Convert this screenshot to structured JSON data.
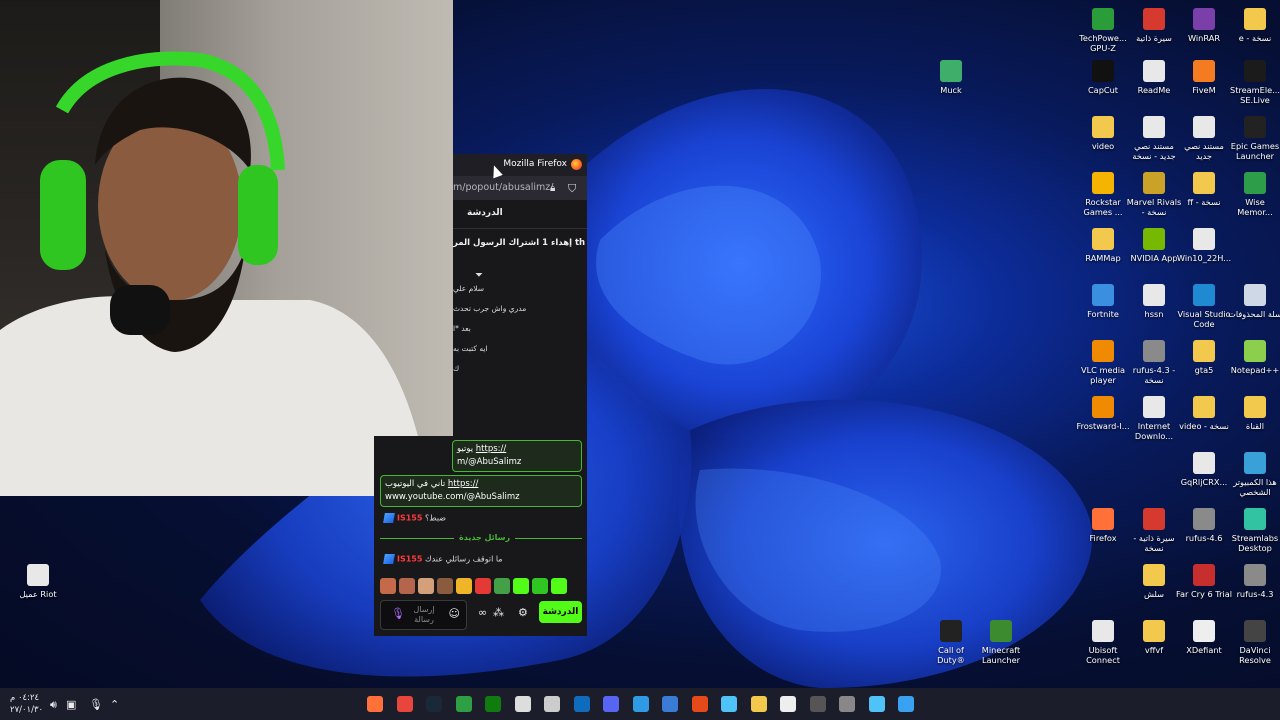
{
  "window": {
    "title": "Mozilla Firefox",
    "url": "m/popout/abusalimz/"
  },
  "chat": {
    "header": "الدردشة",
    "pinned": "إهداء 1 اشتراك الرسول المر th",
    "messages": [
      "سلام علي",
      "مدري واش جرب تحدث",
      "بعد *ا",
      "ايه كتبت به",
      "ك"
    ],
    "link_box_1": {
      "prefix": "يوتيو",
      "link": "https://",
      "line2": "m/@AbuSalimz"
    },
    "link_box_2": {
      "prefix": "تاني في اليوتيوب",
      "link": "https://",
      "line2": "www.youtube.com/@AbuSalimz"
    },
    "user": "IS155",
    "message_1": "ضبط؟",
    "new_messages_label": "رسائل جديدة",
    "message_2": "ما اتوقف رسائلي عندك",
    "input_placeholder": "إرسال رسالة",
    "send_label": "الدردشة"
  },
  "desktop_icons": [
    {
      "label": "TechPowe... GPU-Z",
      "color": "#2a9d3a"
    },
    {
      "label": "سيرة ذاتية",
      "color": "#d63a2f"
    },
    {
      "label": "WinRAR",
      "color": "#7a3fa8"
    },
    {
      "label": "e - نسخة",
      "color": "#f2c94c"
    },
    {
      "label": "Muck",
      "color": "#3fae6a"
    },
    {
      "label": "CapCut",
      "color": "#111111"
    },
    {
      "label": "ReadMe",
      "color": "#e8e8e8"
    },
    {
      "label": "FiveM",
      "color": "#f47b20"
    },
    {
      "label": "StreamEle... SE.Live",
      "color": "#1b1b1b"
    },
    {
      "label": "video",
      "color": "#f2c94c"
    },
    {
      "label": "مستند نصي جديد - نسخة",
      "color": "#e8e8e8"
    },
    {
      "label": "مستند نصي جديد",
      "color": "#e8e8e8"
    },
    {
      "label": "Epic Games Launcher",
      "color": "#222222"
    },
    {
      "label": "Rockstar Games ...",
      "color": "#f4b400"
    },
    {
      "label": "Marvel Rivals - نسخة",
      "color": "#c9a227"
    },
    {
      "label": "ff - نسخة",
      "color": "#f2c94c"
    },
    {
      "label": "Wise Memor...",
      "color": "#2e9d4a"
    },
    {
      "label": "RAMMap",
      "color": "#f2c94c"
    },
    {
      "label": "NVIDIA App",
      "color": "#76b900"
    },
    {
      "label": "Win10_22H...",
      "color": "#e8e8e8"
    },
    {
      "label": "Fortnite",
      "color": "#3b8fe0"
    },
    {
      "label": "hssn",
      "color": "#e8e8e8"
    },
    {
      "label": "Visual Studio Code",
      "color": "#1f8ad2"
    },
    {
      "label": "سلة المحذوفات",
      "color": "#cfd8e6"
    },
    {
      "label": "VLC media player",
      "color": "#f08a00"
    },
    {
      "label": "rufus-4.3 - نسخة",
      "color": "#8a8a8a"
    },
    {
      "label": "gta5",
      "color": "#f2c94c"
    },
    {
      "label": "Notepad++",
      "color": "#8ccf4d"
    },
    {
      "label": "Frostward-I...",
      "color": "#f08a00"
    },
    {
      "label": "Internet Downlo...",
      "color": "#e8e8e8"
    },
    {
      "label": "video - نسخة",
      "color": "#f2c94c"
    },
    {
      "label": "القناة",
      "color": "#f2c94c"
    },
    {
      "label": "GqRljCRX...",
      "color": "#e8e8e8"
    },
    {
      "label": "هذا الكمبيوتر الشخصي",
      "color": "#3aa0d8"
    },
    {
      "label": "Firefox",
      "color": "#ff7139"
    },
    {
      "label": "سيرة ذاتية - نسخة",
      "color": "#d63a2f"
    },
    {
      "label": "rufus-4.6",
      "color": "#8a8a8a"
    },
    {
      "label": "Streamlabs Desktop",
      "color": "#31c3a2"
    },
    {
      "label": "عميل Riot",
      "color": "#e8e8e8"
    },
    {
      "label": "سلش",
      "color": "#f2c94c"
    },
    {
      "label": "Far Cry 6 Trial",
      "color": "#c72f2f"
    },
    {
      "label": "rufus-4.3",
      "color": "#8a8a8a"
    },
    {
      "label": "Call of Duty®",
      "color": "#222222"
    },
    {
      "label": "Minecraft Launcher",
      "color": "#3d8b2f"
    },
    {
      "label": "Ubisoft Connect",
      "color": "#e8e8e8"
    },
    {
      "label": "vffvf",
      "color": "#f2c94c"
    },
    {
      "label": "XDefiant",
      "color": "#eeeeee"
    },
    {
      "label": "DaVinci Resolve",
      "color": "#444444"
    }
  ],
  "taskbar": {
    "clock_time": "٠٤:٢٤ م",
    "clock_date": "٢٧/٠١/٣٠",
    "apps": [
      {
        "name": "firefox-icon",
        "color": "#ff7139"
      },
      {
        "name": "chrome-icon",
        "color": "#e8453c"
      },
      {
        "name": "steam-icon",
        "color": "#1b2838"
      },
      {
        "name": "game-launcher-icon",
        "color": "#2ea043"
      },
      {
        "name": "xbox-icon",
        "color": "#107c10"
      },
      {
        "name": "media-player-icon",
        "color": "#dddddd"
      },
      {
        "name": "settings-icon",
        "color": "#cccccc"
      },
      {
        "name": "outlook-icon",
        "color": "#0f6cbd"
      },
      {
        "name": "discord-icon",
        "color": "#5865f2"
      },
      {
        "name": "photos-icon",
        "color": "#2f9be5"
      },
      {
        "name": "store-icon",
        "color": "#3a7bd5"
      },
      {
        "name": "files-icon",
        "color": "#e64a19"
      },
      {
        "name": "snipping-icon",
        "color": "#4fc3f7"
      },
      {
        "name": "file-explorer-icon",
        "color": "#f2c94c"
      },
      {
        "name": "notepad-icon",
        "color": "#eeeeee"
      },
      {
        "name": "obs-icon",
        "color": "#555555"
      },
      {
        "name": "window-icon",
        "color": "#888888"
      },
      {
        "name": "search-icon",
        "color": "#4fc3f7"
      },
      {
        "name": "start-icon",
        "color": "#3aa0f0"
      }
    ]
  }
}
